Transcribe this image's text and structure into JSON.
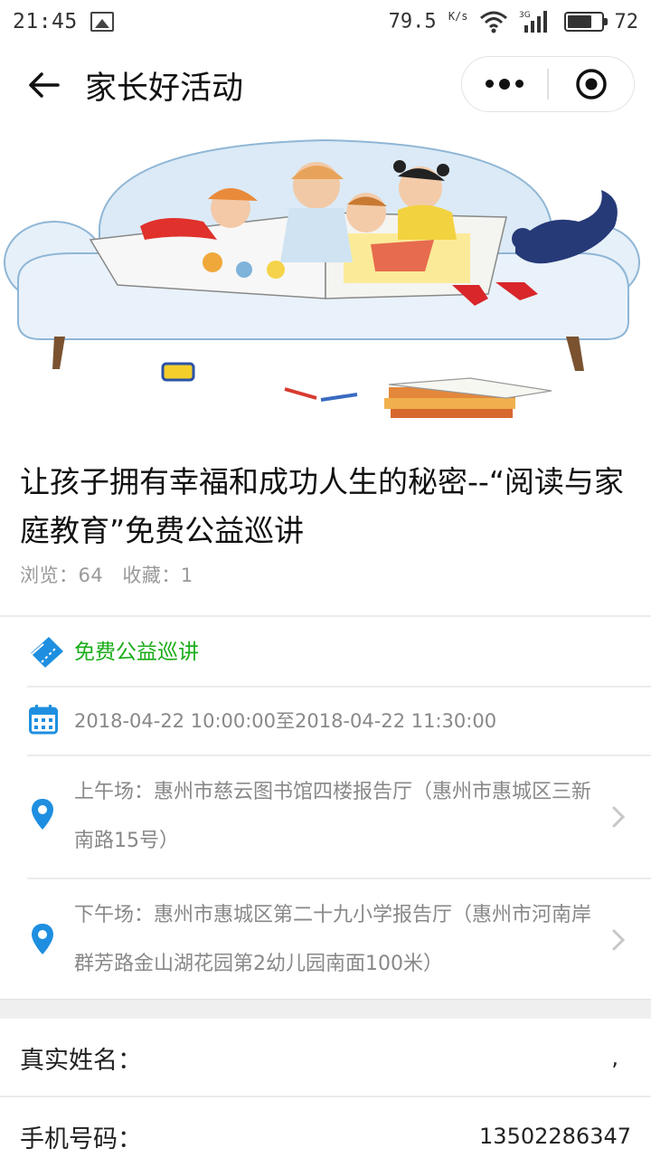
{
  "status_bar": {
    "time": "21:45",
    "net_speed": "79.5",
    "net_unit": "K/s",
    "network_type": "3G",
    "battery_percent": 72,
    "battery_label": "72"
  },
  "nav": {
    "title": "家长好活动"
  },
  "event": {
    "title": "让孩子拥有幸福和成功人生的秘密--“阅读与家庭教育”免费公益巡讲",
    "views_label": "浏览：64",
    "favorites_label": "收藏：1"
  },
  "info": {
    "category": "免费公益巡讲",
    "time_range": "2018-04-22 10:00:00至2018-04-22 11:30:00",
    "location_morning": "上午场：惠州市慈云图书馆四楼报告厅（惠州市惠城区三新南路15号）",
    "location_afternoon": "下午场：惠州市惠城区第二十九小学报告厅（惠州市河南岸群芳路金山湖花园第2幼儿园南面100米）"
  },
  "form": {
    "name_label": "真实姓名：",
    "name_value": ",",
    "phone_label": "手机号码：",
    "phone_value": "13502286347"
  },
  "colors": {
    "accent_green": "#1aad19",
    "icon_blue": "#1e8fe0",
    "muted_text": "#888888"
  },
  "icons": {
    "back": "arrow-left-icon",
    "more": "more-dots-icon",
    "close": "target-circle-icon",
    "category": "ticket-icon",
    "calendar": "calendar-icon",
    "location": "map-pin-icon",
    "chevron": "chevron-right-icon"
  }
}
